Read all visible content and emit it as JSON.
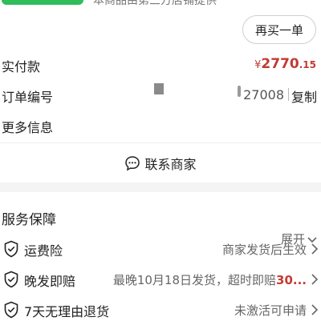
{
  "header": {
    "top_note": "本商品由第三方店铺提供",
    "rebuy_label": "再买一单"
  },
  "payment": {
    "label": "实付款",
    "currency": "¥",
    "amount_main": "2770",
    "amount_decimal": ".15"
  },
  "order": {
    "label": "订单编号",
    "number_visible": "27008",
    "copy_label": "复制"
  },
  "more": {
    "label": "更多信息",
    "expand_label": "展开"
  },
  "contact": {
    "label": "联系商家"
  },
  "service": {
    "title": "服务保障",
    "items": [
      {
        "name": "运费险",
        "value": "商家发货后生效"
      },
      {
        "name": "晚发即赔",
        "value_prefix": "最晚10月18日发货，超时即赔",
        "value_highlight": "30..."
      },
      {
        "name": "7天无理由退货",
        "value": "未激活可申请"
      }
    ]
  },
  "colors": {
    "accent": "#c23b33",
    "brand_green": "#2fbd5a"
  }
}
